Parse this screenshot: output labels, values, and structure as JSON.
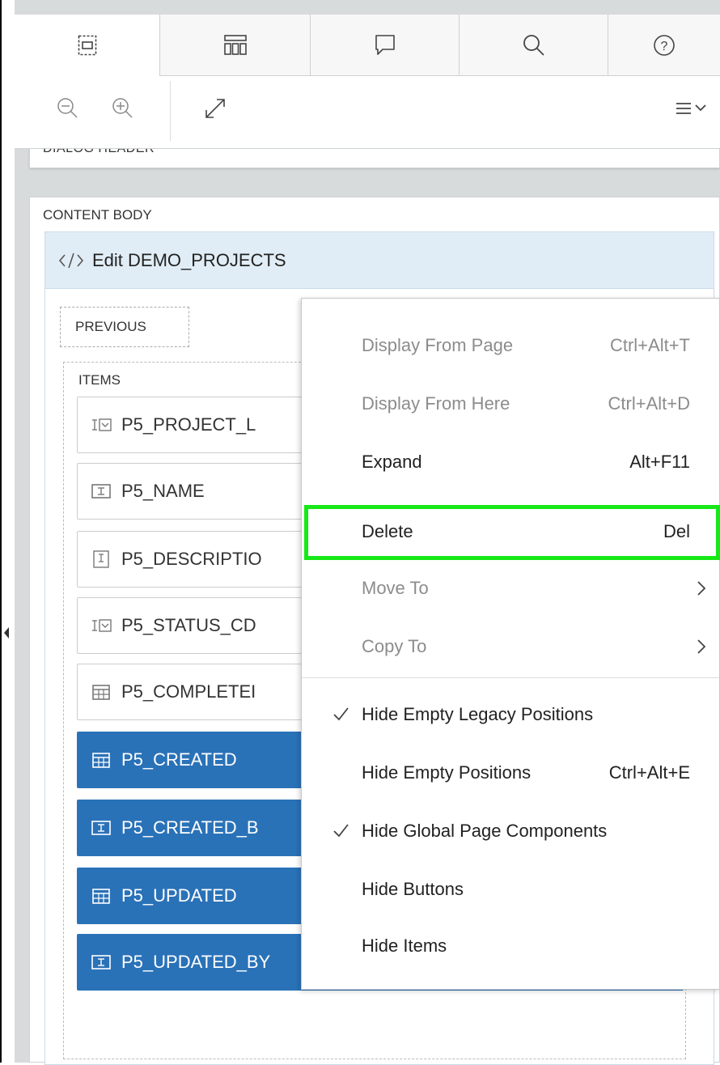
{
  "toolbar": {
    "tabs": [
      {
        "icon": "grid-layout-icon",
        "active": true
      },
      {
        "icon": "component-gallery-icon",
        "active": false
      },
      {
        "icon": "message-bubble-icon",
        "active": false
      },
      {
        "icon": "search-icon",
        "active": false
      },
      {
        "icon": "help-icon",
        "active": false
      }
    ],
    "tools": [
      "zoom-out-icon",
      "zoom-in-icon",
      "expand-icon",
      "menu-icon"
    ]
  },
  "dialog_header": {
    "label": "DIALOG HEADER"
  },
  "content_body": {
    "label": "CONTENT BODY",
    "region": {
      "title": "Edit DEMO_PROJECTS",
      "icon": "code-icon"
    },
    "previous": "PREVIOUS",
    "items_label": "ITEMS",
    "items": [
      {
        "name": "P5_PROJECT_L",
        "icon": "select-list-icon",
        "style": "white"
      },
      {
        "name": "P5_NAME",
        "icon": "text-field-icon",
        "style": "white"
      },
      {
        "name": "P5_DESCRIPTIO",
        "icon": "textarea-icon",
        "style": "white"
      },
      {
        "name": "P5_STATUS_CD",
        "icon": "select-list-icon",
        "style": "white"
      },
      {
        "name": "P5_COMPLETEI",
        "icon": "date-picker-icon",
        "style": "white"
      },
      {
        "name": "P5_CREATED",
        "icon": "date-picker-icon",
        "style": "blue"
      },
      {
        "name": "P5_CREATED_B",
        "icon": "text-field-icon",
        "style": "blue"
      },
      {
        "name": "P5_UPDATED",
        "icon": "date-picker-icon",
        "style": "blue"
      },
      {
        "name": "P5_UPDATED_BY",
        "icon": "text-field-icon",
        "style": "blue"
      }
    ]
  },
  "context_menu": {
    "items": [
      {
        "label": "Display From Page",
        "shortcut": "Ctrl+Alt+T",
        "disabled": true
      },
      {
        "label": "Display From Here",
        "shortcut": "Ctrl+Alt+D",
        "disabled": true
      },
      {
        "label": "Expand",
        "shortcut": "Alt+F11",
        "disabled": false
      },
      {
        "label": "Delete",
        "shortcut": "Del",
        "disabled": false,
        "highlighted": true
      },
      {
        "label": "Move To",
        "shortcut": "",
        "disabled": true,
        "submenu": true
      },
      {
        "label": "Copy To",
        "shortcut": "",
        "disabled": true,
        "submenu": true
      },
      {
        "label": "Hide Empty Legacy Positions",
        "shortcut": "",
        "disabled": false,
        "checked": true
      },
      {
        "label": "Hide Empty Positions",
        "shortcut": "Ctrl+Alt+E",
        "disabled": false,
        "checked": false
      },
      {
        "label": "Hide Global Page Components",
        "shortcut": "",
        "disabled": false,
        "checked": true
      },
      {
        "label": "Hide Buttons",
        "shortcut": "",
        "disabled": false,
        "checked": false
      },
      {
        "label": "Hide Items",
        "shortcut": "",
        "disabled": false,
        "checked": false
      }
    ],
    "highlight_color": "#17e817"
  },
  "colors": {
    "item_blue": "#2a72b8",
    "region_header": "#e1edf6",
    "gutter": "#d7dbdb"
  }
}
